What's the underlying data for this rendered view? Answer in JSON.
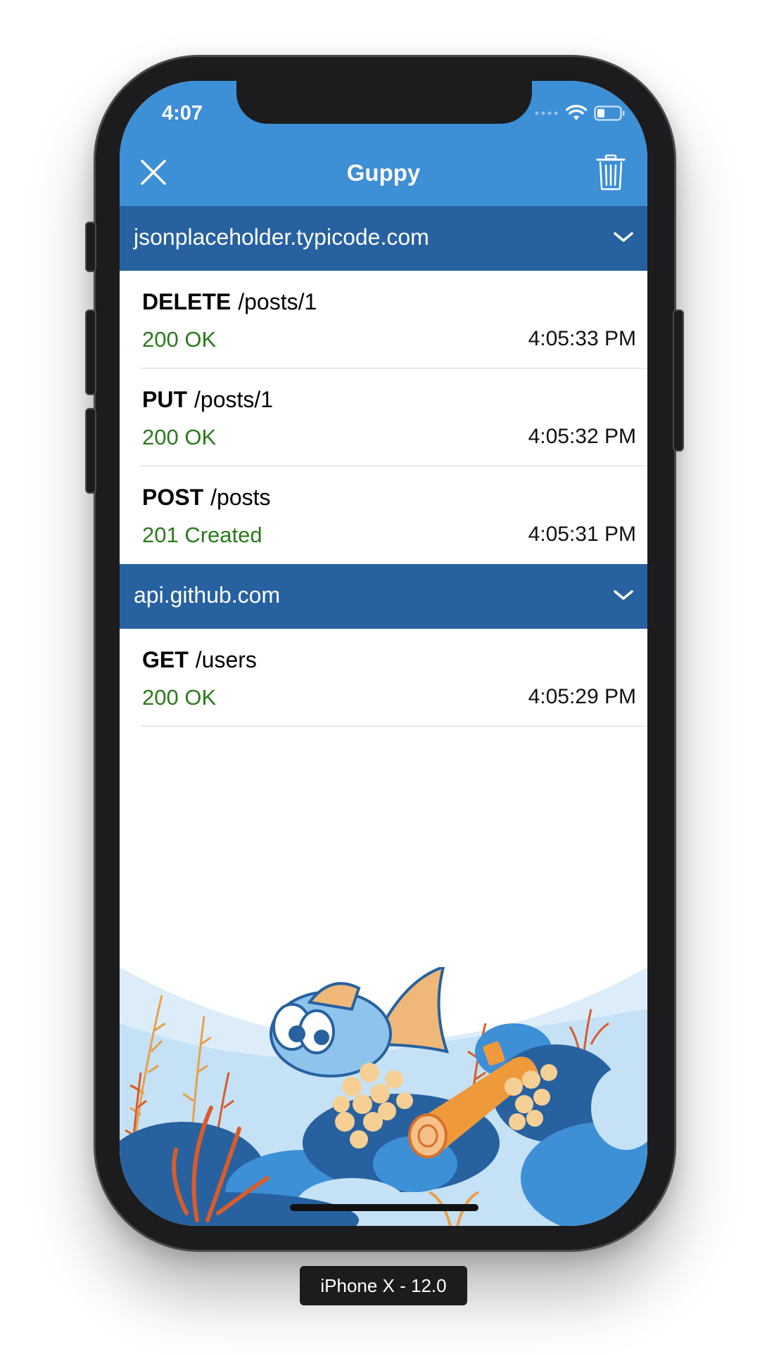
{
  "status_bar": {
    "time": "4:07",
    "icons": [
      "signal-dots-icon",
      "wifi-icon",
      "battery-icon"
    ]
  },
  "navbar": {
    "title": "Guppy",
    "close_icon": "close-icon",
    "trash_icon": "trash-icon"
  },
  "sections": [
    {
      "host": "jsonplaceholder.typicode.com",
      "requests": [
        {
          "method": "DELETE",
          "path": "/posts/1",
          "status": "200 OK",
          "time": "4:05:33 PM"
        },
        {
          "method": "PUT",
          "path": "/posts/1",
          "status": "200 OK",
          "time": "4:05:32 PM"
        },
        {
          "method": "POST",
          "path": "/posts",
          "status": "201 Created",
          "time": "4:05:31 PM"
        }
      ]
    },
    {
      "host": "api.github.com",
      "requests": [
        {
          "method": "GET",
          "path": "/users",
          "status": "200 OK",
          "time": "4:05:29 PM"
        }
      ]
    }
  ],
  "simulator_label": "iPhone X - 12.0",
  "colors": {
    "navbar": "#3d8fd6",
    "section_header": "#2761a0",
    "status_success": "#2a7a1c",
    "device_frame": "#1c1c1e"
  }
}
